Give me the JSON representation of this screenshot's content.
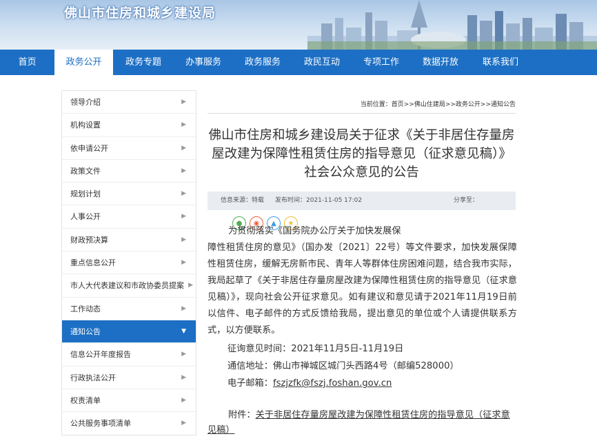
{
  "site": {
    "title": "佛山市住房和城乡建设局"
  },
  "nav": {
    "items": [
      {
        "label": "首页"
      },
      {
        "label": "政务公开"
      },
      {
        "label": "政务专题"
      },
      {
        "label": "办事服务"
      },
      {
        "label": "政务服务"
      },
      {
        "label": "政民互动"
      },
      {
        "label": "专项工作"
      },
      {
        "label": "数据开放"
      },
      {
        "label": "联系我们"
      }
    ],
    "active_index": 1
  },
  "sidebar": {
    "items": [
      {
        "label": "领导介绍"
      },
      {
        "label": "机构设置"
      },
      {
        "label": "依申请公开"
      },
      {
        "label": "政策文件"
      },
      {
        "label": "规划计划"
      },
      {
        "label": "人事公开"
      },
      {
        "label": "财政预决算"
      },
      {
        "label": "重点信息公开"
      },
      {
        "label": "市人大代表建议和市政协委员提案"
      },
      {
        "label": "工作动态"
      },
      {
        "label": "通知公告"
      },
      {
        "label": "信息公开年度报告"
      },
      {
        "label": "行政执法公开"
      },
      {
        "label": "权责清单"
      },
      {
        "label": "公共服务事项清单"
      }
    ],
    "active_index": 10
  },
  "breadcrumb": "当前位置：首页>>佛山住建局>>政务公开>>通知公告",
  "article": {
    "title": "佛山市住房和城乡建设局关于征求《关于非居住存量房屋改建为保障性租赁住房的指导意见（征求意见稿）》社会公众意见的公告",
    "source": "信息来源：特载",
    "publish_time": "发布时间：2021-11-05 17:02",
    "share_label": "分享至：",
    "share_icons": [
      "wechat-icon",
      "weibo-icon",
      "qq-icon",
      "qzone-icon"
    ],
    "paragraph_part1": "为贯彻落实《国务院办公厅关于加快发展保",
    "paragraph_part2": "障性租赁住房的意见》（国办发〔2021〕22号）等文件要求，加快发展保障性租赁住房，缓解无房新市民、青年人等群体住房困难问题，结合我市实际，我局起草了《关于非居住存量房屋改建为保障性租赁住房的指导意见（征求意见稿）》，现向社会公开征求意见。如有建议和意见请于2021年11月19日前以信件、电子邮件的方式反馈给我局，提出意见的单位或个人请提供联系方式，以方便联系。",
    "period": "征询意见时间：2021年11月5日-11月19日",
    "address": "通信地址：佛山市禅城区城门头西路4号（邮编528000）",
    "email_label": "电子邮箱：",
    "email": "fszjzfk@fszj.foshan.gov.cn",
    "attachment_label": "附件：",
    "attachment_link": "关于非居住存量房屋改建为保障性租赁住房的指导意见（征求意见稿）"
  },
  "colors": {
    "primary": "#1c6fc4",
    "meta_bg": "#e9edf2"
  }
}
